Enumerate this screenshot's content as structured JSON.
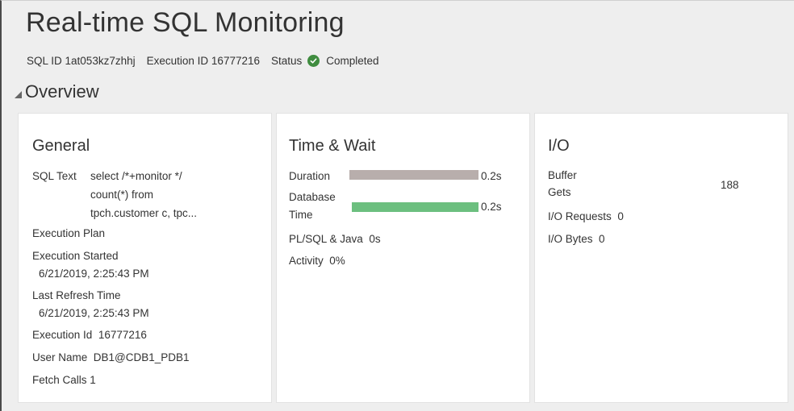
{
  "header": {
    "title": "Real-time SQL Monitoring",
    "sql_id_label": "SQL ID",
    "sql_id_value": "1at053kz7zhhj",
    "execution_id_label": "Execution ID",
    "execution_id_value": "16777216",
    "status_label": "Status",
    "status_value": "Completed",
    "status_color": "#3f8c3f"
  },
  "overview": {
    "label": "Overview"
  },
  "general": {
    "title": "General",
    "sql_text_label": "SQL Text",
    "sql_text_lines": [
      "select /*+monitor */",
      "count(*) from",
      "tpch.customer c, tpc..."
    ],
    "execution_plan_label": "Execution Plan",
    "execution_started_label": "Execution Started",
    "execution_started_value": "6/21/2019, 2:25:43 PM",
    "last_refresh_label": "Last Refresh Time",
    "last_refresh_value": "6/21/2019, 2:25:43 PM",
    "execution_id_label": "Execution Id",
    "execution_id_value": "16777216",
    "user_name_label": "User Name",
    "user_name_value": "DB1@CDB1_PDB1",
    "fetch_calls_label": "Fetch Calls",
    "fetch_calls_value": "1"
  },
  "time_wait": {
    "title": "Time & Wait",
    "duration_label": "Duration",
    "duration_value": "0.2s",
    "duration_fraction": 1.0,
    "duration_color": "#b8aeac",
    "db_time_label_1": "Database",
    "db_time_label_2": "Time",
    "db_time_value": "0.2s",
    "db_time_fraction": 1.0,
    "db_time_color": "#6cbf7f",
    "plsql_label": "PL/SQL & Java",
    "plsql_value": "0s",
    "activity_label": "Activity",
    "activity_value": "0%"
  },
  "io": {
    "title": "I/O",
    "buffer_gets_label_1": "Buffer",
    "buffer_gets_label_2": "Gets",
    "buffer_gets_value": "188",
    "io_requests_label": "I/O Requests",
    "io_requests_value": "0",
    "io_bytes_label": "I/O Bytes",
    "io_bytes_value": "0"
  }
}
